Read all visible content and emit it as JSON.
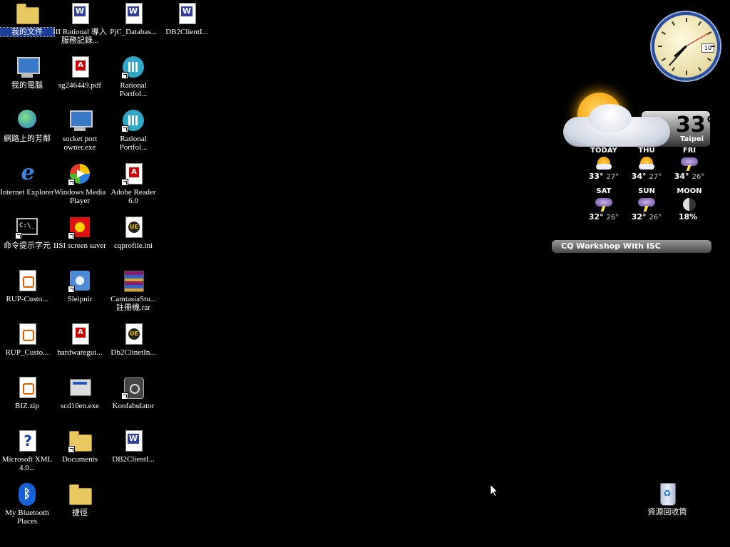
{
  "desktop_icons": [
    {
      "label": "我的文件",
      "type": "folder-docs",
      "col": 0,
      "row": 0,
      "selected": true
    },
    {
      "label": "III Rational 導入服務記錄...",
      "type": "word",
      "col": 1,
      "row": 0
    },
    {
      "label": "PjC_Databas...",
      "type": "word",
      "col": 2,
      "row": 0
    },
    {
      "label": "DB2ClientI...",
      "type": "word",
      "col": 3,
      "row": 0
    },
    {
      "label": "我的電腦",
      "type": "computer",
      "col": 0,
      "row": 1
    },
    {
      "label": "sg246449.pdf",
      "type": "pdf",
      "col": 1,
      "row": 1
    },
    {
      "label": "Rational Portfol...",
      "type": "rational-chart",
      "col": 2,
      "row": 1,
      "shortcut": true
    },
    {
      "label": "網路上的芳鄰",
      "type": "network",
      "col": 0,
      "row": 2
    },
    {
      "label": "socket port owner.exe",
      "type": "exe",
      "col": 1,
      "row": 2
    },
    {
      "label": "Rational Portfol...",
      "type": "rational-chart",
      "col": 2,
      "row": 2,
      "shortcut": true
    },
    {
      "label": "Internet Explorer",
      "type": "ie",
      "col": 0,
      "row": 3
    },
    {
      "label": "Windows Media Player",
      "type": "media",
      "col": 1,
      "row": 3,
      "shortcut": true
    },
    {
      "label": "Adobe Reader 6.0",
      "type": "pdf",
      "col": 2,
      "row": 3,
      "shortcut": true
    },
    {
      "label": "命令提示字元",
      "type": "cmd",
      "col": 0,
      "row": 4,
      "shortcut": true
    },
    {
      "label": "IISI screen saver",
      "type": "saver",
      "col": 1,
      "row": 4,
      "shortcut": true
    },
    {
      "label": "cqprofile.ini",
      "type": "ue",
      "col": 2,
      "row": 4
    },
    {
      "label": "RUP-Custo...",
      "type": "rup",
      "col": 0,
      "row": 5
    },
    {
      "label": "Sleipnir",
      "type": "sleipnir",
      "col": 1,
      "row": 5,
      "shortcut": true
    },
    {
      "label": "CamtasiaStu... 註冊機.rar",
      "type": "rar",
      "col": 2,
      "row": 5
    },
    {
      "label": "RUP_Custo...",
      "type": "rup",
      "col": 0,
      "row": 6
    },
    {
      "label": "hardwaregui...",
      "type": "pdf",
      "col": 1,
      "row": 6
    },
    {
      "label": "Db2ClinetIn...",
      "type": "ue",
      "col": 2,
      "row": 6
    },
    {
      "label": "BIZ.zip",
      "type": "rup",
      "col": 0,
      "row": 7
    },
    {
      "label": "scd10en.exe",
      "type": "scd",
      "col": 1,
      "row": 7
    },
    {
      "label": "Konfabulator",
      "type": "konf",
      "col": 2,
      "row": 7,
      "shortcut": true
    },
    {
      "label": "Microsoft XML 4.0...",
      "type": "xml",
      "col": 0,
      "row": 8
    },
    {
      "label": "Documents",
      "type": "folder",
      "col": 1,
      "row": 8,
      "shortcut": true
    },
    {
      "label": "DB2ClientI...",
      "type": "word",
      "col": 2,
      "row": 8
    },
    {
      "label": "My Bluetooth Places",
      "type": "bluetooth",
      "col": 0,
      "row": 9
    },
    {
      "label": "捷徑",
      "type": "folder",
      "col": 1,
      "row": 9
    }
  ],
  "recycle_bin": {
    "label": "資源回收筒"
  },
  "clock": {
    "date": "10",
    "hour": 7,
    "minute": 37,
    "second": 10
  },
  "weather": {
    "current_temp": "33°",
    "city": "Taipei",
    "forecast": [
      {
        "day": "TODAY",
        "icon": "sunny",
        "hi": "33°",
        "lo": "27°"
      },
      {
        "day": "THU",
        "icon": "sunny",
        "hi": "34°",
        "lo": "27°"
      },
      {
        "day": "FRI",
        "icon": "storm",
        "hi": "34°",
        "lo": "26°"
      },
      {
        "day": "SAT",
        "icon": "storm",
        "hi": "32°",
        "lo": "26°"
      },
      {
        "day": "SUN",
        "icon": "storm",
        "hi": "32°",
        "lo": "26°"
      },
      {
        "day": "MOON",
        "icon": "moon",
        "hi": "18%",
        "lo": ""
      }
    ]
  },
  "widget_title": "CQ Workshop With ISC",
  "colors": {
    "desktop_background": "#000000",
    "selection": "#1c3e98"
  }
}
